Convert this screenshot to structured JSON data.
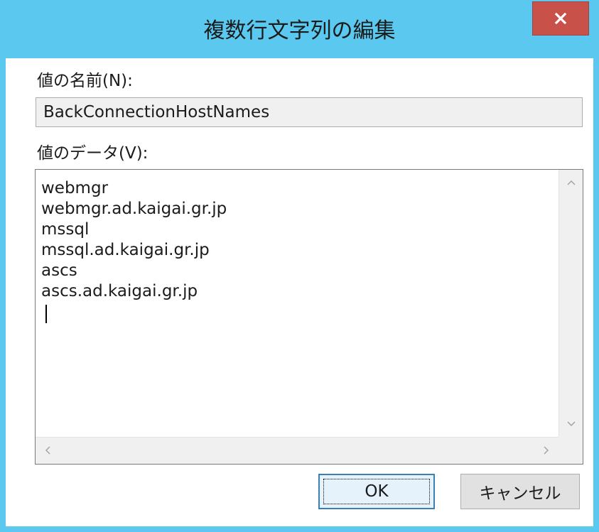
{
  "window": {
    "title": "複数行文字列の編集"
  },
  "value_name": {
    "label": "値の名前(N):",
    "value": "BackConnectionHostNames"
  },
  "value_data": {
    "label": "値のデータ(V):",
    "lines": [
      "webmgr",
      "webmgr.ad.kaigai.gr.jp",
      "mssql",
      "mssql.ad.kaigai.gr.jp",
      "ascs",
      "ascs.ad.kaigai.gr.jp"
    ]
  },
  "buttons": {
    "ok": "OK",
    "cancel": "キャンセル"
  },
  "icons": {
    "close": "close-icon",
    "scroll_up": "chevron-up-icon",
    "scroll_down": "chevron-down-icon",
    "scroll_left": "chevron-left-icon",
    "scroll_right": "chevron-right-icon"
  },
  "colors": {
    "titlebar": "#5ac8ef",
    "close_button": "#c8514a",
    "ok_border": "#3c7fb1"
  }
}
